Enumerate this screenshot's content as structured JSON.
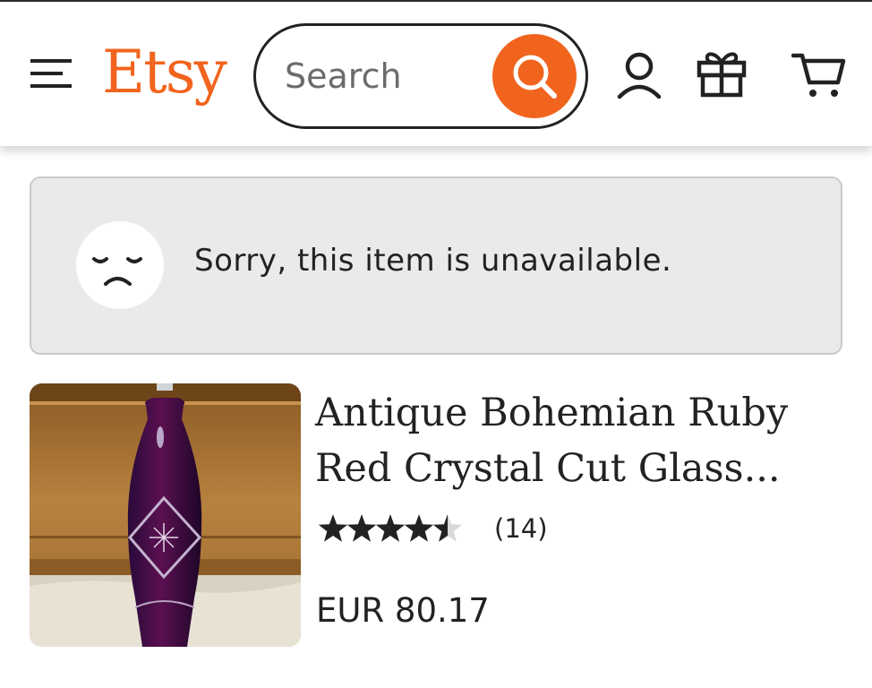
{
  "header": {
    "logo": "Etsy",
    "search": {
      "placeholder": "Search",
      "value": ""
    },
    "icons": [
      "hamburger-menu-icon",
      "search-icon",
      "user-account-icon",
      "gift-icon",
      "cart-icon"
    ],
    "brand_color": "#F1641E"
  },
  "notice": {
    "message": "Sorry, this item is unavailable.",
    "icon": "sad-face-icon"
  },
  "listing": {
    "title_line1": "Antique Bohemian Ruby",
    "title_line2": "Red Crystal Cut Glass...",
    "rating": 4.5,
    "review_count": "(14)",
    "price": "EUR 80.17"
  }
}
